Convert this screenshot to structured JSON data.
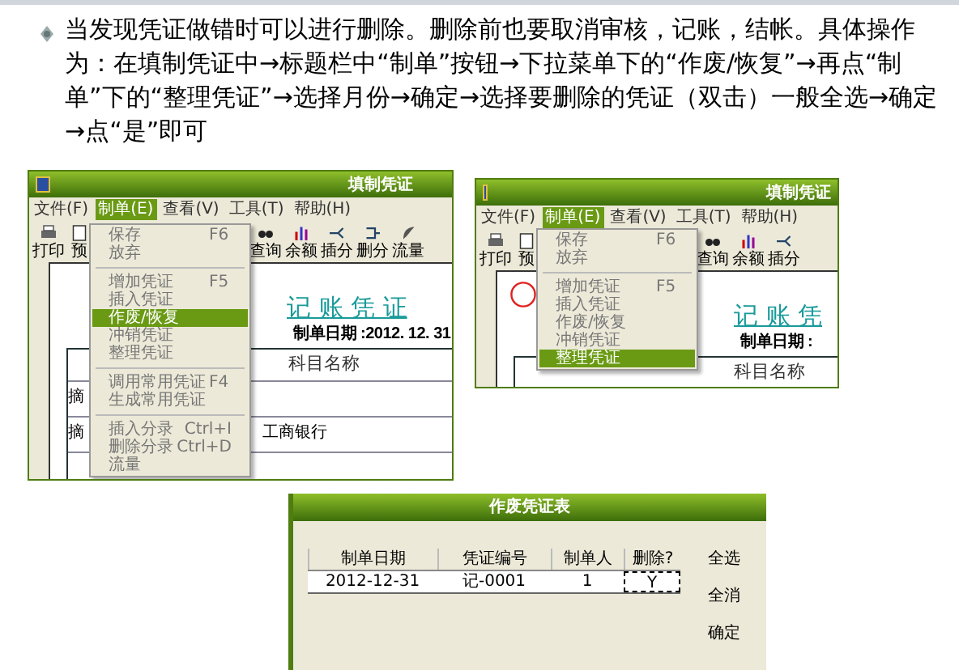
{
  "slide": {
    "text": "当发现凭证做错时可以进行删除。删除前也要取消审核，记账，结帐。具体操作为：在填制凭证中→标题栏中“制单”按钮→下拉菜单下的“作废/恢复”→再点“制单”下的“整理凭证”→选择月份→确定→选择要删除的凭证（双击）一般全选→确定→点“是”即可"
  },
  "windows": [
    {
      "title": "填制凭证",
      "menus": [
        {
          "label": "文件(F)",
          "selected": false
        },
        {
          "label": "制单(E)",
          "selected": true
        },
        {
          "label": "查看(V)",
          "selected": false
        },
        {
          "label": "工具(T)",
          "selected": false
        },
        {
          "label": "帮助(H)",
          "selected": false
        }
      ],
      "toolbar": [
        "打印",
        "预",
        "查询",
        "余额",
        "插分",
        "删分",
        "流量"
      ],
      "dropdown": [
        {
          "kind": "item",
          "label": "保存",
          "shortcut": "F6",
          "selected": false
        },
        {
          "kind": "item",
          "label": "放弃",
          "selected": false
        },
        {
          "kind": "separator"
        },
        {
          "kind": "item",
          "label": "增加凭证",
          "shortcut": "F5",
          "selected": false
        },
        {
          "kind": "item",
          "label": "插入凭证",
          "selected": false
        },
        {
          "kind": "item",
          "label": "作废/恢复",
          "selected": true
        },
        {
          "kind": "item",
          "label": "冲销凭证",
          "selected": false
        },
        {
          "kind": "item",
          "label": "整理凭证",
          "selected": false
        },
        {
          "kind": "separator"
        },
        {
          "kind": "item",
          "label": "调用常用凭证",
          "shortcut": "F4",
          "selected": false
        },
        {
          "kind": "item",
          "label": "生成常用凭证",
          "selected": false
        },
        {
          "kind": "separator"
        },
        {
          "kind": "item",
          "label": "插入分录",
          "shortcut": "Ctrl+I",
          "selected": false
        },
        {
          "kind": "item",
          "label": "删除分录",
          "shortcut": "Ctrl+D",
          "selected": false
        },
        {
          "kind": "item",
          "label": "流量",
          "selected": false
        }
      ],
      "voucher": {
        "stamp": false,
        "title": "记 账 凭 证",
        "date": "制单日期 :2012. 12. 31",
        "column": "科目名称",
        "rows": [
          {
            "summary": "摘"
          },
          {
            "summary": "摘",
            "account": "工商银行"
          }
        ]
      }
    },
    {
      "title": "填制凭证",
      "menus": [
        {
          "label": "文件(F)",
          "selected": false
        },
        {
          "label": "制单(E)",
          "selected": true
        },
        {
          "label": "查看(V)",
          "selected": false
        },
        {
          "label": "工具(T)",
          "selected": false
        },
        {
          "label": "帮助(H)",
          "selected": false
        }
      ],
      "toolbar": [
        "打印",
        "预",
        "查询",
        "余额",
        "插分"
      ],
      "dropdown": [
        {
          "kind": "item",
          "label": "保存",
          "shortcut": "F6",
          "selected": false
        },
        {
          "kind": "item",
          "label": "放弃",
          "selected": false
        },
        {
          "kind": "separator"
        },
        {
          "kind": "item",
          "label": "增加凭证",
          "shortcut": "F5",
          "selected": false
        },
        {
          "kind": "item",
          "label": "插入凭证",
          "selected": false
        },
        {
          "kind": "item",
          "label": "作废/恢复",
          "selected": false
        },
        {
          "kind": "item",
          "label": "冲销凭证",
          "selected": false
        },
        {
          "kind": "item",
          "label": "整理凭证",
          "selected": true
        }
      ],
      "voucher": {
        "stamp": true,
        "title": "记 账 凭",
        "date": "制单日期 :",
        "column": "科目名称"
      }
    }
  ],
  "dialog": {
    "title": "作废凭证表",
    "columns": [
      "制单日期",
      "凭证编号",
      "制单人",
      "删除?"
    ],
    "rows": [
      [
        "2012-12-31",
        "记-0001",
        "1",
        "Y"
      ]
    ],
    "buttons": [
      "全选",
      "全消",
      "确定"
    ]
  }
}
